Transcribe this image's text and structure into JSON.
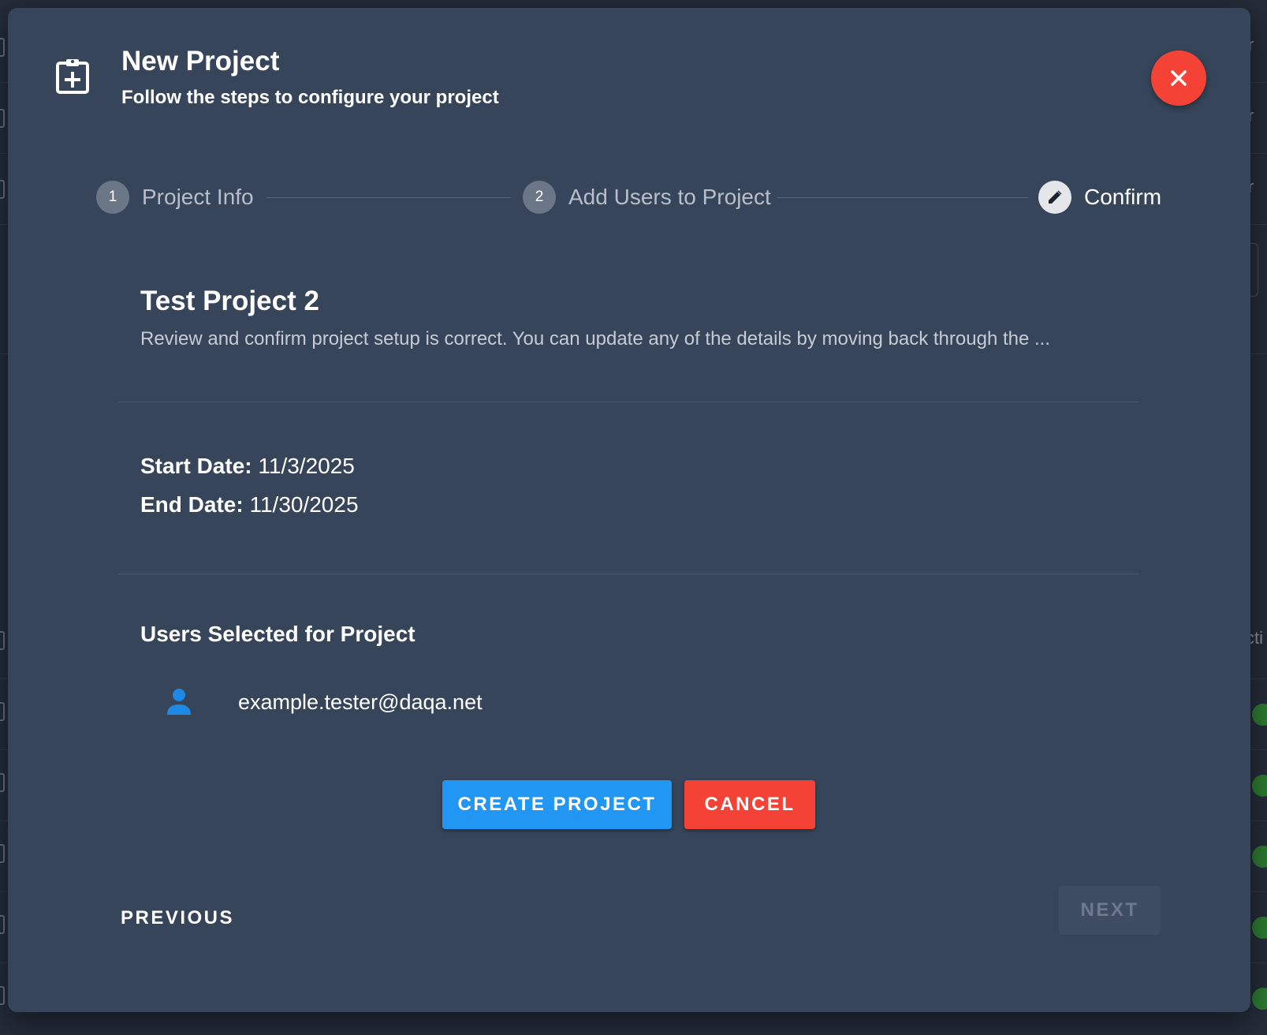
{
  "background": {
    "right_text_fragments": [
      "r",
      "r",
      "r",
      "cti"
    ]
  },
  "dialog": {
    "title": "New Project",
    "subtitle": "Follow the steps to configure your project",
    "header_icon": "clipboard-plus-icon",
    "close_icon": "close-icon"
  },
  "stepper": {
    "steps": [
      {
        "number": "1",
        "label": "Project Info",
        "state": "completed"
      },
      {
        "number": "2",
        "label": "Add Users to Project",
        "state": "completed"
      },
      {
        "number": "",
        "label": "Confirm",
        "state": "active",
        "icon": "pencil-icon"
      }
    ]
  },
  "summary": {
    "project_name": "Test Project 2",
    "description": "Review and confirm project setup is correct. You can update any of the details by moving back through the ...",
    "start_date_label": "Start Date:",
    "start_date_value": "11/3/2025",
    "end_date_label": "End Date:",
    "end_date_value": "11/30/2025",
    "users_heading": "Users Selected for Project",
    "users": [
      {
        "email": "example.tester@daqa.net",
        "icon": "person-icon"
      }
    ]
  },
  "actions": {
    "create_label": "CREATE PROJECT",
    "cancel_label": "CANCEL"
  },
  "navigation": {
    "previous_label": "PREVIOUS",
    "next_label": "NEXT",
    "next_disabled": true
  },
  "colors": {
    "dialog_bg": "#364559",
    "primary": "#2196f3",
    "danger": "#f44336",
    "user_icon": "#1e88e5"
  }
}
